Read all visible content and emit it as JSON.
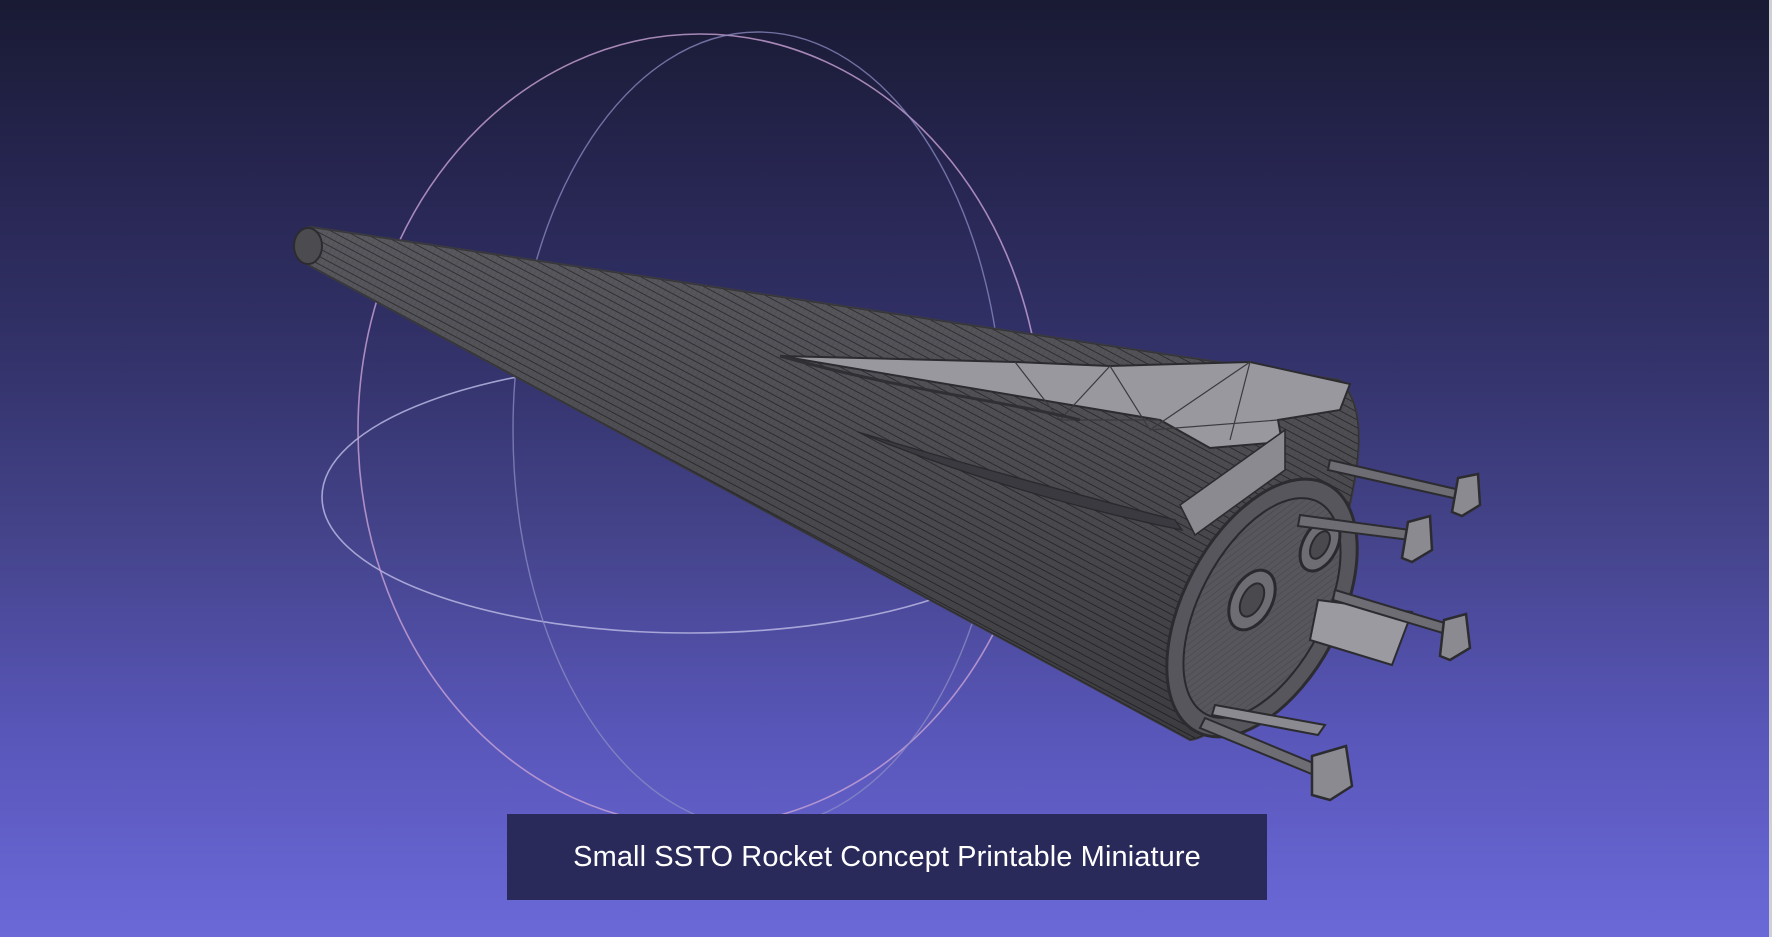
{
  "viewer": {
    "caption": "Small SSTO Rocket Concept Printable Miniature"
  },
  "trackball": {
    "icon": "trackball-gizmo-icon",
    "colors": {
      "horizontal_ring": "#b8b6e2",
      "vertical_ring_a": "#d4a4d8",
      "vertical_ring_b": "#8e8cc4"
    }
  },
  "model": {
    "icon": "rocket-wireframe-icon",
    "render_mode": "wireframe",
    "colors": {
      "fill": "#6a6a70",
      "wire": "#2c2c30",
      "wing": "#9a9aa0"
    }
  },
  "colors": {
    "background_top": "#191a33",
    "background_bottom": "#6b69d8",
    "caption_background": "#29295a",
    "caption_text": "#ffffff"
  }
}
